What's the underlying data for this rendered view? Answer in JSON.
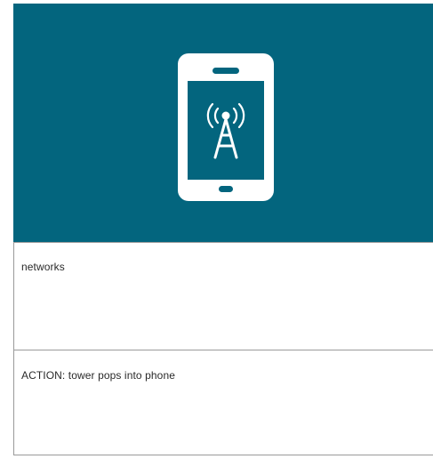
{
  "illustration": {
    "icon": "phone-with-cell-tower-icon",
    "background_color": "#03657e",
    "icon_color": "#ffffff"
  },
  "cells": [
    {
      "text": "networks"
    },
    {
      "text": "ACTION: tower pops into phone"
    }
  ]
}
